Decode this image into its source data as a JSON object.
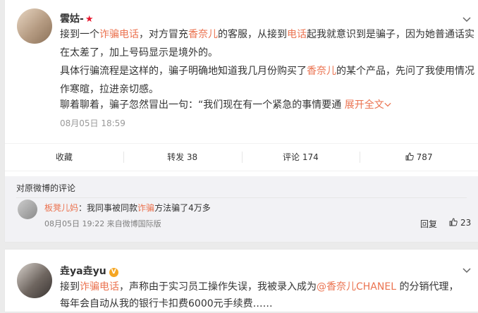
{
  "post1": {
    "username": "雲姑-",
    "badge": "★",
    "para1": {
      "t1": "接到一个",
      "h1": "诈骗电话",
      "t2": "，对方冒充",
      "h2": "香奈儿",
      "t3": "的客服，从接到",
      "h3": "电话",
      "t4": "起我就意识到是骗子，因为她普通话实在太差了，加上号码显示是境外的。"
    },
    "para2": {
      "t1": "具体行骗流程是这样的，骗子明确地知道我几月份购买了",
      "h1": "香奈儿",
      "t2": "的某个产品，先问了我使用情况作寒暄，拉进亲切感。"
    },
    "para3": {
      "t1": "聊着聊着，骗子忽然冒出一句：“我们现在有一个紧急的事情要通 ",
      "expand": "展开全文"
    },
    "time": "08月05日 18:59",
    "actions": {
      "fav": "收藏",
      "repost": "转发 38",
      "comment": "评论 174",
      "like": "787"
    },
    "comments": {
      "header": "对原微博的评论",
      "user": "板凳儿妈",
      "colon": "：",
      "t1": "我同事被同款",
      "h1": "诈骗",
      "t2": "方法骗了4万多",
      "meta": "08月05日 19:22 来自微博国际版",
      "reply": "回复",
      "like": "23"
    }
  },
  "post2": {
    "username": "垚ya垚yu",
    "badge": "V",
    "para1": {
      "t1": "接到",
      "h1": "诈骗电话",
      "t2": "，声称由于实习员工操作失误，我被录入成为",
      "link": "@香奈儿CHANEL",
      "t3": " 的分销代理，"
    },
    "para2": "每年会自动从我的银行卡扣费6000元手续费……"
  },
  "icons": {
    "chevron": "chevron-down-icon",
    "thumb": "thumb-up-icon"
  },
  "colors": {
    "accent": "#eb7350",
    "text": "#333333",
    "meta": "#999999",
    "bg": "#ebebeb"
  }
}
